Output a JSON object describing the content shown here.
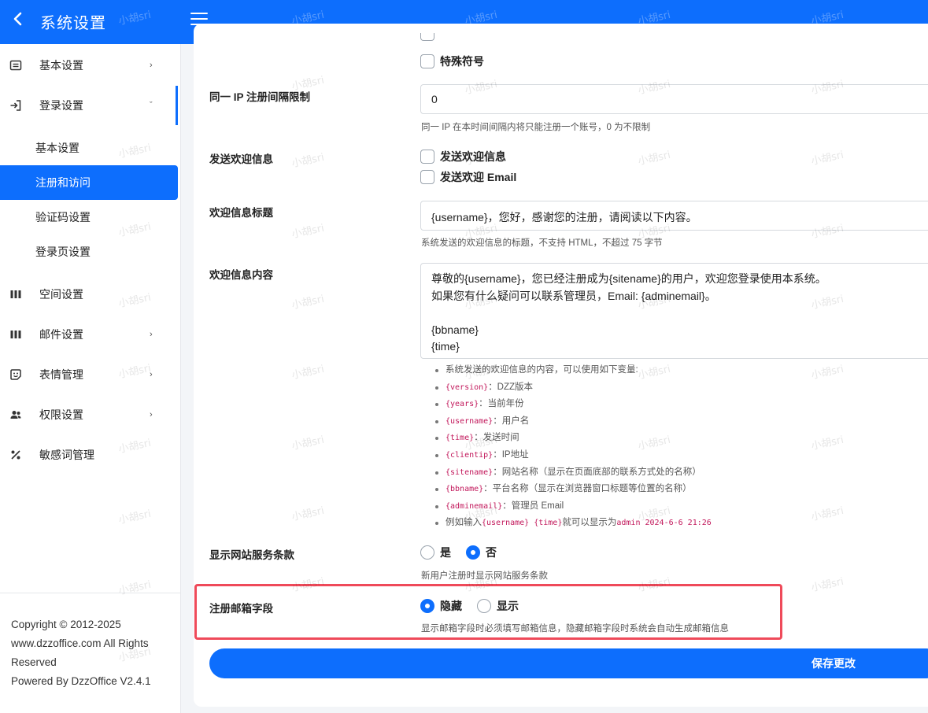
{
  "header": {
    "title": "系统设置"
  },
  "sidebar": {
    "items": [
      {
        "label": "基本设置",
        "icon": "list-icon",
        "chevron": "›"
      },
      {
        "label": "登录设置",
        "icon": "login-icon",
        "chevron": "ˇ"
      },
      {
        "label": "空间设置",
        "icon": "columns-icon"
      },
      {
        "label": "邮件设置",
        "icon": "columns-icon",
        "chevron": "›"
      },
      {
        "label": "表情管理",
        "icon": "sticker-icon",
        "chevron": "›"
      },
      {
        "label": "权限设置",
        "icon": "users-icon",
        "chevron": "›"
      },
      {
        "label": "敏感词管理",
        "icon": "percent-icon"
      }
    ],
    "sub_items": [
      "基本设置",
      "注册和访问",
      "验证码设置",
      "登录页设置"
    ],
    "footer": {
      "copyright": "Copyright © 2012-2025",
      "rights": "www.dzzoffice.com All Rights Reserved",
      "powered": "Powered By DzzOffice V2.4.1"
    }
  },
  "form": {
    "special_chars_label": "特殊符号",
    "ip_limit": {
      "label": "同一 IP 注册间隔限制",
      "value": "0",
      "hint": "同一 IP 在本时间间隔内将只能注册一个账号，0 为不限制"
    },
    "welcome_msg": {
      "label": "发送欢迎信息",
      "option1": "发送欢迎信息",
      "option2": "发送欢迎 Email"
    },
    "welcome_title": {
      "label": "欢迎信息标题",
      "value": "{username}，您好，感谢您的注册，请阅读以下内容。",
      "hint": "系统发送的欢迎信息的标题，不支持 HTML，不超过 75 字节"
    },
    "welcome_content": {
      "label": "欢迎信息内容",
      "value": "尊敬的{username}，您已经注册成为{sitename}的用户，欢迎您登录使用本系统。\n如果您有什么疑问可以联系管理员，Email: {adminemail}。\n\n{bbname}\n{time}"
    },
    "variables": {
      "intro": "系统发送的欢迎信息的内容，可以使用如下变量:",
      "vars": [
        {
          "code": "{version}",
          "desc": "：DZZ版本"
        },
        {
          "code": "{years}",
          "desc": "：当前年份"
        },
        {
          "code": "{username}",
          "desc": "：用户名"
        },
        {
          "code": "{time}",
          "desc": "：发送时间"
        },
        {
          "code": "{clientip}",
          "desc": "：IP地址"
        },
        {
          "code": "{sitename}",
          "desc": "：网站名称（显示在页面底部的联系方式处的名称）"
        },
        {
          "code": "{bbname}",
          "desc": "：平台名称（显示在浏览器窗口标题等位置的名称）"
        },
        {
          "code": "{adminemail}",
          "desc": "：管理员 Email"
        }
      ],
      "example_prefix": "例如输入",
      "example_code": "{username} {time}",
      "example_mid": "就可以显示为",
      "example_result": "admin 2024-6-6 21:26"
    },
    "terms": {
      "label": "显示网站服务条款",
      "yes": "是",
      "no": "否",
      "selected": "否",
      "hint": "新用户注册时显示网站服务条款"
    },
    "email_field": {
      "label": "注册邮箱字段",
      "hide": "隐藏",
      "show": "显示",
      "selected": "隐藏",
      "hint": "显示邮箱字段时必须填写邮箱信息，隐藏邮箱字段时系统会自动生成邮箱信息"
    },
    "save_label": "保存更改"
  },
  "watermark": "小胡sri",
  "colors": {
    "primary": "#0d6efd",
    "highlight": "#ef4a5a",
    "code": "#c2185b"
  }
}
